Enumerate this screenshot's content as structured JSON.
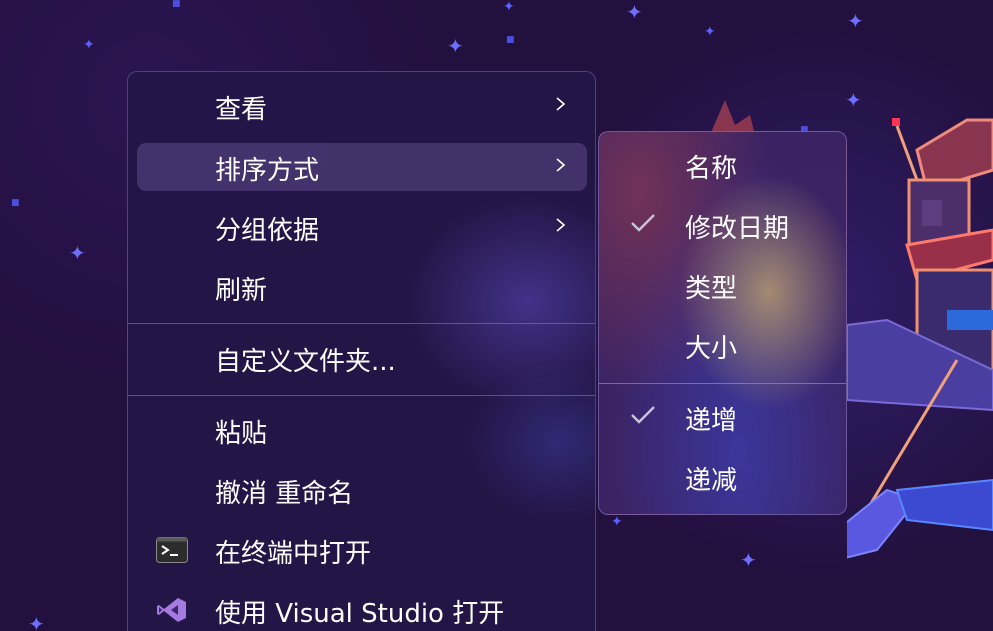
{
  "menu": {
    "items": [
      {
        "label": "查看",
        "submenu": true
      },
      {
        "label": "排序方式",
        "submenu": true,
        "highlighted": true
      },
      {
        "label": "分组依据",
        "submenu": true
      },
      {
        "label": "刷新"
      },
      {
        "label": "自定义文件夹..."
      },
      {
        "label": "粘贴"
      },
      {
        "label": "撤消 重命名"
      },
      {
        "label": "在终端中打开",
        "icon": "terminal-icon"
      },
      {
        "label": "使用 Visual Studio 打开",
        "icon": "visual-studio-icon"
      }
    ]
  },
  "submenu": {
    "items": [
      {
        "label": "名称",
        "checked": false
      },
      {
        "label": "修改日期",
        "checked": true
      },
      {
        "label": "类型",
        "checked": false
      },
      {
        "label": "大小",
        "checked": false
      },
      {
        "label": "递增",
        "checked": true
      },
      {
        "label": "递减",
        "checked": false
      }
    ]
  },
  "colors": {
    "menu_background": "#241648",
    "highlight": "#6e5a9c",
    "text": "#ffffff",
    "separator": "#8c7db9",
    "visual_studio_purple": "#a57be0"
  }
}
